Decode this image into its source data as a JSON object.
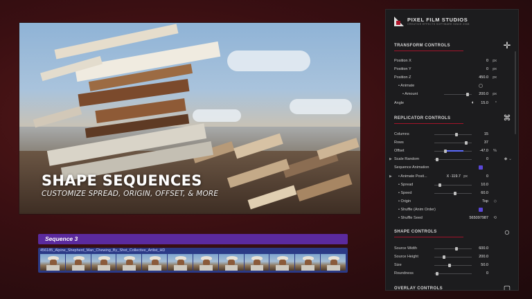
{
  "viewer": {
    "headline": "SHAPE SEQUENCES",
    "subline": "CUSTOMIZE SPREAD, ORIGIN, OFFSET, & MORE"
  },
  "timeline": {
    "sequence_label": "Sequence 3",
    "clip_name": "456185_Alpine_Shepherd_Man_Chewing_By_Shot_Collective_Artlist_HD",
    "thumbnail_count": 12
  },
  "panel": {
    "brand_name": "PIXEL FILM STUDIOS",
    "brand_tagline": "CREATIVE EFFECTS SOFTWARE SINCE 2008",
    "accent_color": "#a3132a",
    "transform": {
      "title": "TRANSFORM CONTROLS",
      "icon": "move-arrows-icon",
      "rows": [
        {
          "label": "Position X",
          "value": "0",
          "unit": "px"
        },
        {
          "label": "Position Y",
          "value": "0",
          "unit": "px"
        },
        {
          "label": "Position Z",
          "value": "450.0",
          "unit": "px"
        },
        {
          "label": "Animate",
          "value": "",
          "unit": ""
        },
        {
          "label": "Amount",
          "value": "200.0",
          "unit": "px"
        },
        {
          "label": "Angle",
          "value": "15.0",
          "unit": "°"
        }
      ]
    },
    "replicator": {
      "title": "REPLICATOR CONTROLS",
      "icon": "replicator-icon",
      "rows": [
        {
          "label": "Columns",
          "value": "15",
          "unit": ""
        },
        {
          "label": "Rows",
          "value": "37",
          "unit": ""
        },
        {
          "label": "Offset",
          "value": "-47.0",
          "unit": "%"
        },
        {
          "label": "Scale Random",
          "value": "0",
          "unit": ""
        },
        {
          "label": "Sequence Animation",
          "value": "",
          "unit": ""
        },
        {
          "label": "Animate Posit...",
          "value": "X -119.7",
          "unit": "px",
          "extra": "0"
        },
        {
          "label": "Spread",
          "value": "10.0",
          "unit": ""
        },
        {
          "label": "Speed",
          "value": "60.0",
          "unit": ""
        },
        {
          "label": "Origin",
          "value": "Top",
          "unit": "◇"
        },
        {
          "label": "Shuffle (Anim Order)",
          "value": "",
          "unit": ""
        },
        {
          "label": "Shuffle Seed",
          "value": "565097987",
          "unit": "⟲"
        }
      ]
    },
    "shape": {
      "title": "SHAPE CONTROLS",
      "icon": "circle-shape-icon",
      "rows": [
        {
          "label": "Source Width",
          "value": "600.0",
          "unit": ""
        },
        {
          "label": "Source Height",
          "value": "200.0",
          "unit": ""
        },
        {
          "label": "Size",
          "value": "50.0",
          "unit": ""
        },
        {
          "label": "Roundness",
          "value": "0",
          "unit": ""
        }
      ]
    },
    "overlay": {
      "title": "OVERLAY CONTROLS",
      "icon": "overlay-icon"
    }
  }
}
